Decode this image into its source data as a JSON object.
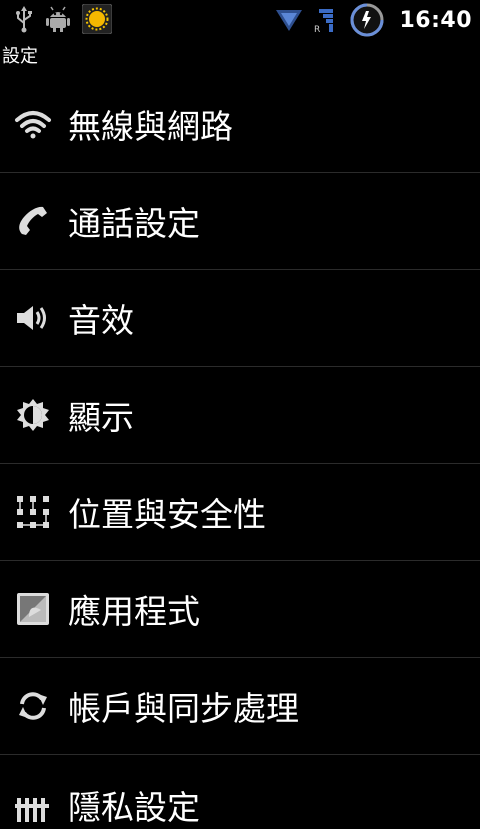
{
  "status_bar": {
    "time": "16:40",
    "left_icons": [
      "usb-icon",
      "android-debug-icon",
      "weather-sun-icon"
    ],
    "right_icons": [
      "wifi-signal-icon",
      "roaming-signal-icon",
      "battery-charging-icon"
    ],
    "roaming_letter": "R"
  },
  "header": {
    "title": "設定"
  },
  "settings": {
    "items": [
      {
        "label": "無線與網路",
        "icon": "wifi-icon"
      },
      {
        "label": "通話設定",
        "icon": "phone-icon"
      },
      {
        "label": "音效",
        "icon": "speaker-icon"
      },
      {
        "label": "顯示",
        "icon": "brightness-icon"
      },
      {
        "label": "位置與安全性",
        "icon": "location-security-grid-icon"
      },
      {
        "label": "應用程式",
        "icon": "android-apps-icon"
      },
      {
        "label": "帳戶與同步處理",
        "icon": "sync-icon"
      },
      {
        "label": "隱私設定",
        "icon": "privacy-icon"
      }
    ]
  }
}
